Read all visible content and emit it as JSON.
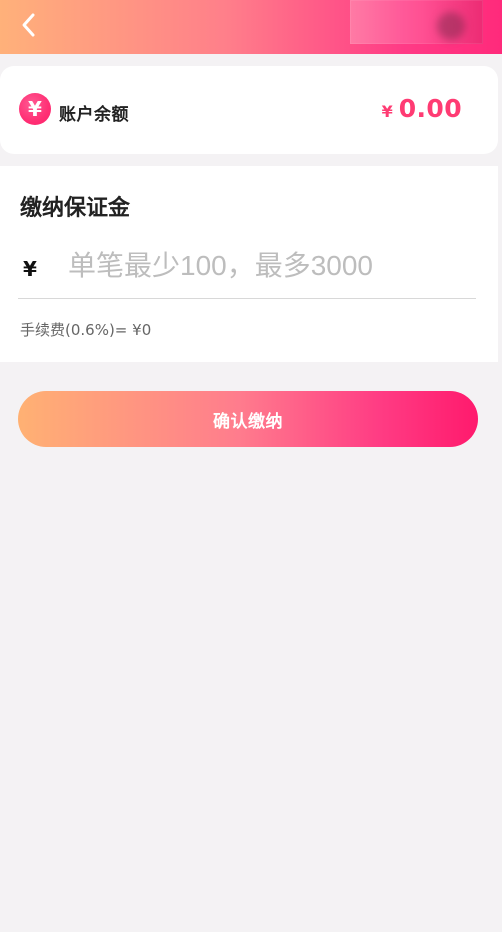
{
  "header": {
    "back_icon": "chevron-left-icon"
  },
  "balance": {
    "icon": "yen-icon",
    "label": "账户余额",
    "currency_symbol": "¥",
    "value": "0.00"
  },
  "deposit": {
    "title": "缴纳保证金",
    "currency_symbol": "¥",
    "input_value": "",
    "input_placeholder": "单笔最少100，最多3000",
    "fee_text": "手续费(0.6%)= ¥0"
  },
  "actions": {
    "confirm_label": "确认缴纳"
  },
  "colors": {
    "accent_start": "#ffb173",
    "accent_mid": "#ff7c8d",
    "accent_end": "#ff1a6d",
    "price_pink": "#ff3b73",
    "background": "#f4f2f4"
  }
}
